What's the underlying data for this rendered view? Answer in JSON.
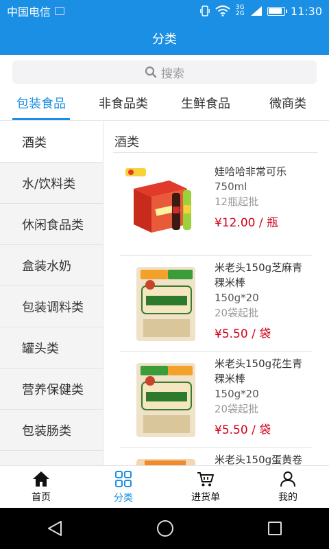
{
  "status": {
    "carrier": "中国电信",
    "network": "3G 2G",
    "time": "11:30"
  },
  "header": {
    "title": "分类"
  },
  "search": {
    "placeholder": "搜索"
  },
  "tabs": [
    {
      "label": "包装食品",
      "active": true
    },
    {
      "label": "非食品类",
      "active": false
    },
    {
      "label": "生鲜食品",
      "active": false
    },
    {
      "label": "微商类",
      "active": false
    }
  ],
  "sidebar": {
    "items": [
      {
        "label": "酒类",
        "active": true
      },
      {
        "label": "水/饮料类",
        "active": false
      },
      {
        "label": "休闲食品类",
        "active": false
      },
      {
        "label": "盒装水奶",
        "active": false
      },
      {
        "label": "包装调料类",
        "active": false
      },
      {
        "label": "罐头类",
        "active": false
      },
      {
        "label": "营养保健类",
        "active": false
      },
      {
        "label": "包装肠类",
        "active": false
      },
      {
        "label": "",
        "active": false
      }
    ]
  },
  "main": {
    "section_title": "酒类",
    "products": [
      {
        "name": "娃哈哈非常可乐",
        "spec": "750ml",
        "min_order": "12瓶起批",
        "price": "¥12.00 / 瓶",
        "image": "cola-case-image"
      },
      {
        "name": "米老头150g芝麻青稞米棒",
        "spec": "150g*20",
        "min_order": "20袋起批",
        "price": "¥5.50 / 袋",
        "image": "rice-bar-pack-image"
      },
      {
        "name": "米老头150g花生青稞米棒",
        "spec": "150g*20",
        "min_order": "20袋起批",
        "price": "¥5.50 / 袋",
        "image": "rice-bar-pack-image"
      },
      {
        "name": "米老头150g蛋黄卷",
        "spec": "",
        "min_order": "",
        "price": "",
        "image": "snack-roll-image"
      }
    ]
  },
  "bottom_nav": [
    {
      "label": "首页",
      "icon": "home-icon",
      "active": false
    },
    {
      "label": "分类",
      "icon": "grid-icon",
      "active": true
    },
    {
      "label": "进货单",
      "icon": "cart-icon",
      "active": false
    },
    {
      "label": "我的",
      "icon": "person-icon",
      "active": false
    }
  ],
  "colors": {
    "accent": "#1a8fe3",
    "price": "#d0021b"
  }
}
